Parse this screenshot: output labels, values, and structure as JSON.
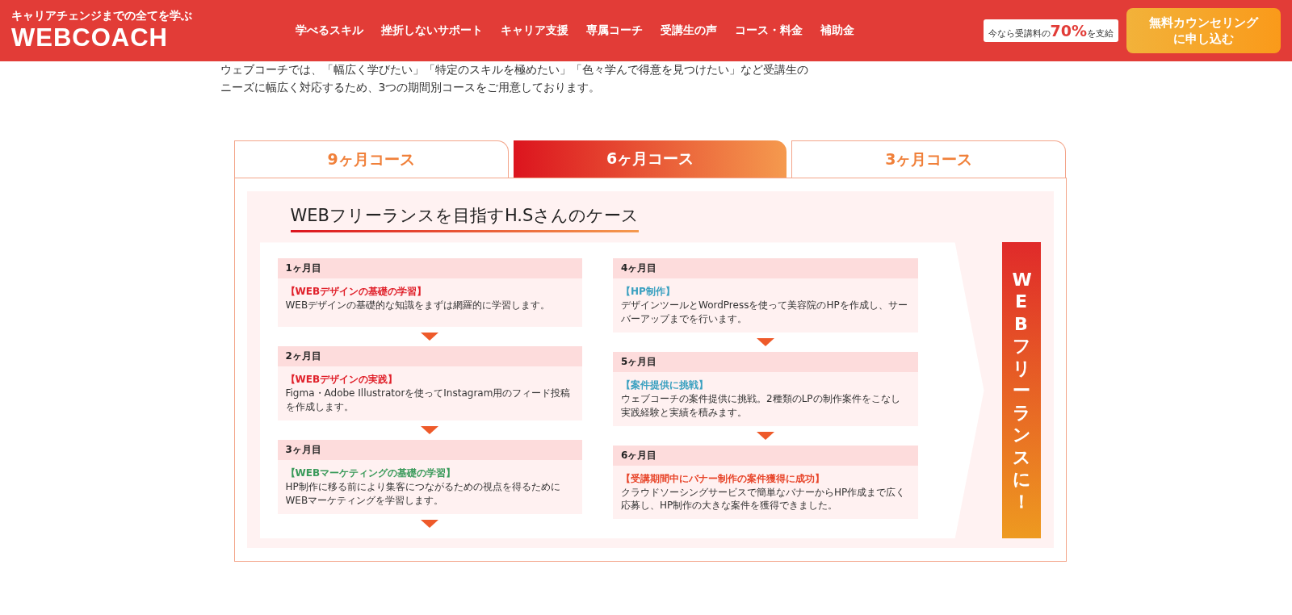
{
  "header": {
    "tagline": "キャリアチェンジまでの全てを学ぶ",
    "logo": "WEBCOACH",
    "nav": [
      "学べるスキル",
      "挫折しないサポート",
      "キャリア支援",
      "専属コーチ",
      "受講生の声",
      "コース・料金",
      "補助金"
    ],
    "badge": "今なら受講料の**70%**を支給",
    "cta": [
      "無料カウンセリング",
      "に申し込む"
    ]
  },
  "intro": "ウェブコーチでは、「幅広く学びたい」「特定のスキルを極めたい」「色々学んで得意を見つけたい」など受講生のニーズに幅広く対応するため、3つの期間別コースをご用意しております。",
  "tabs": [
    {
      "label": "9ヶ月コース",
      "selected": false
    },
    {
      "label": "6ヶ月コース",
      "selected": true
    },
    {
      "label": "3ヶ月コース",
      "selected": false
    }
  ],
  "case_title": "WEBフリーランスを目指すH.Sさんのケース",
  "columns": [
    {
      "steps": [
        {
          "month": "1ヶ月目",
          "title": "【WEBデザインの基礎の学習】",
          "color": "#e0202a",
          "text": "WEBデザインの基礎的な知識をまずは網羅的に学習します。",
          "arrow_below": true
        },
        {
          "month": "2ヶ月目",
          "title": "【WEBデザインの実践】",
          "color": "#e0202a",
          "text": "Figma・Adobe Illustratorを使ってInstagram用のフィード投稿を作成します。",
          "arrow_below": true
        },
        {
          "month": "3ヶ月目",
          "title": "【WEBマーケティングの基礎の学習】",
          "color": "#3a9a5a",
          "text": "HP制作に移る前により集客につながるための視点を得るためにWEBマーケティングを学習します。",
          "arrow_below": true
        }
      ]
    },
    {
      "steps": [
        {
          "month": "4ヶ月目",
          "title": "【HP制作】",
          "color": "#3aa0c0",
          "text": "デザインツールとWordPressを使って美容院のHPを作成し、サーバーアップまでを行います。",
          "arrow_below": true
        },
        {
          "month": "5ヶ月目",
          "title": "【案件提供に挑戦】",
          "color": "#3aa0c0",
          "text": "ウェブコーチの案件提供に挑戦。2種類のLPの制作案件をこなし実践経験と実績を積みます。",
          "arrow_below": true
        },
        {
          "month": "6ヶ月目",
          "title": "【受講期間中にバナー制作の案件獲得に成功】",
          "color": "#e8452a",
          "text": "クラウドソーシングサービスで簡単なバナーからHP作成まで広く応募し、HP制作の大きな案件を獲得できました。",
          "arrow_below": false
        }
      ]
    }
  ],
  "goal": "WEBフリーランスに！"
}
